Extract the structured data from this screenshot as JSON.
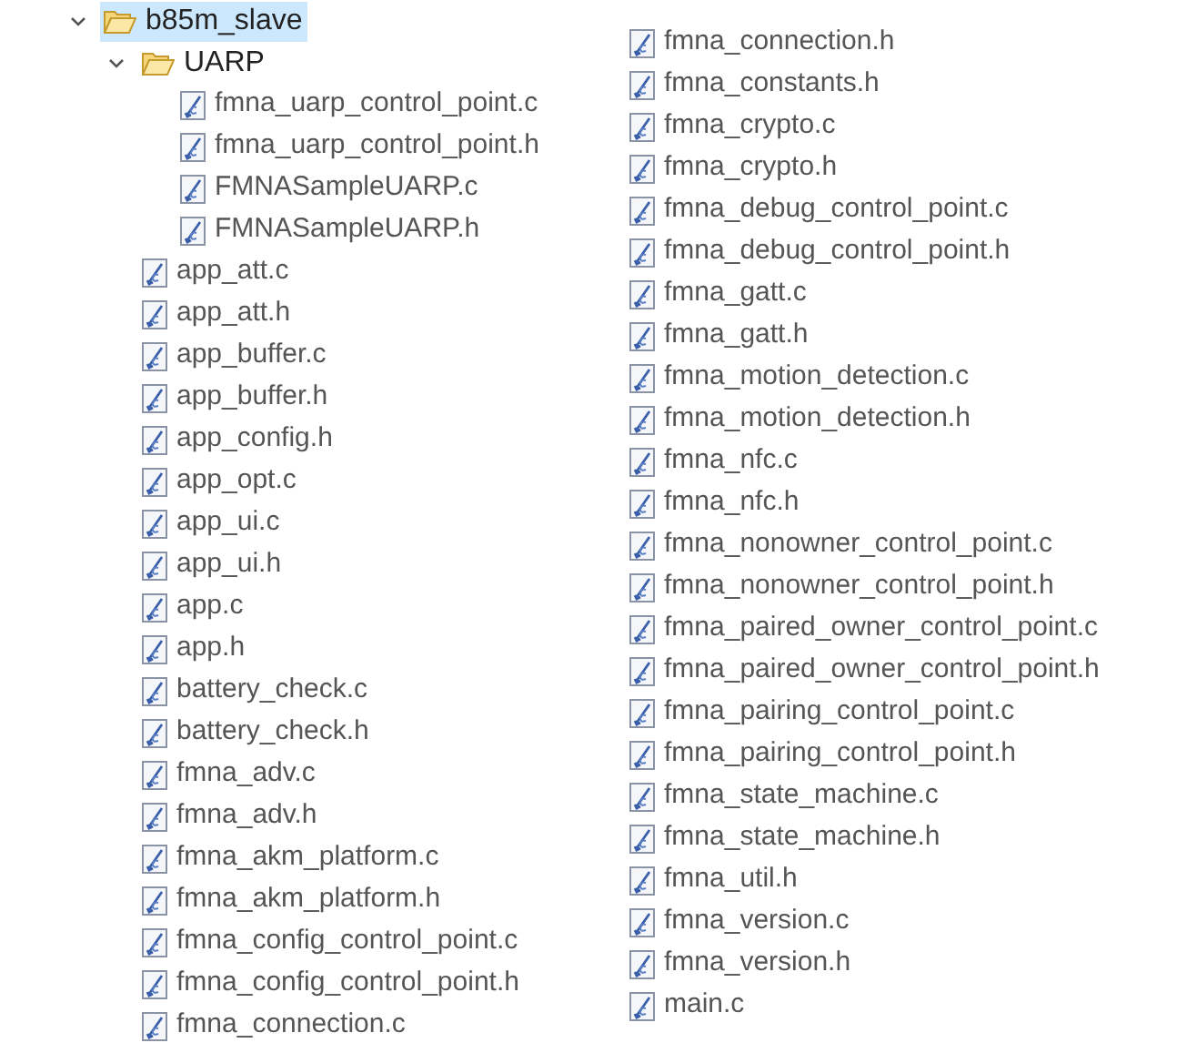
{
  "tree": [
    {
      "kind": "folder",
      "label": "b85m_slave",
      "expanded": true,
      "selected": true,
      "children": [
        {
          "kind": "folder",
          "label": "UARP",
          "expanded": true,
          "selected": false,
          "children": [
            {
              "kind": "file",
              "label": "fmna_uarp_control_point.c"
            },
            {
              "kind": "file",
              "label": "fmna_uarp_control_point.h"
            },
            {
              "kind": "file",
              "label": "FMNASampleUARP.c"
            },
            {
              "kind": "file",
              "label": "FMNASampleUARP.h"
            }
          ]
        },
        {
          "kind": "file",
          "label": "app_att.c"
        },
        {
          "kind": "file",
          "label": "app_att.h"
        },
        {
          "kind": "file",
          "label": "app_buffer.c"
        },
        {
          "kind": "file",
          "label": "app_buffer.h"
        },
        {
          "kind": "file",
          "label": "app_config.h"
        },
        {
          "kind": "file",
          "label": "app_opt.c"
        },
        {
          "kind": "file",
          "label": "app_ui.c"
        },
        {
          "kind": "file",
          "label": "app_ui.h"
        },
        {
          "kind": "file",
          "label": "app.c"
        },
        {
          "kind": "file",
          "label": "app.h"
        },
        {
          "kind": "file",
          "label": "battery_check.c"
        },
        {
          "kind": "file",
          "label": "battery_check.h"
        },
        {
          "kind": "file",
          "label": "fmna_adv.c"
        },
        {
          "kind": "file",
          "label": "fmna_adv.h"
        },
        {
          "kind": "file",
          "label": "fmna_akm_platform.c"
        },
        {
          "kind": "file",
          "label": "fmna_akm_platform.h"
        },
        {
          "kind": "file",
          "label": "fmna_config_control_point.c"
        },
        {
          "kind": "file",
          "label": "fmna_config_control_point.h"
        },
        {
          "kind": "file",
          "label": "fmna_connection.c"
        }
      ]
    }
  ],
  "continued": [
    {
      "kind": "file",
      "label": "fmna_connection.h"
    },
    {
      "kind": "file",
      "label": "fmna_constants.h"
    },
    {
      "kind": "file",
      "label": "fmna_crypto.c"
    },
    {
      "kind": "file",
      "label": "fmna_crypto.h"
    },
    {
      "kind": "file",
      "label": "fmna_debug_control_point.c"
    },
    {
      "kind": "file",
      "label": "fmna_debug_control_point.h"
    },
    {
      "kind": "file",
      "label": "fmna_gatt.c"
    },
    {
      "kind": "file",
      "label": "fmna_gatt.h"
    },
    {
      "kind": "file",
      "label": "fmna_motion_detection.c"
    },
    {
      "kind": "file",
      "label": "fmna_motion_detection.h"
    },
    {
      "kind": "file",
      "label": "fmna_nfc.c"
    },
    {
      "kind": "file",
      "label": "fmna_nfc.h"
    },
    {
      "kind": "file",
      "label": "fmna_nonowner_control_point.c"
    },
    {
      "kind": "file",
      "label": "fmna_nonowner_control_point.h"
    },
    {
      "kind": "file",
      "label": "fmna_paired_owner_control_point.c"
    },
    {
      "kind": "file",
      "label": "fmna_paired_owner_control_point.h"
    },
    {
      "kind": "file",
      "label": "fmna_pairing_control_point.c"
    },
    {
      "kind": "file",
      "label": "fmna_pairing_control_point.h"
    },
    {
      "kind": "file",
      "label": "fmna_state_machine.c"
    },
    {
      "kind": "file",
      "label": "fmna_state_machine.h"
    },
    {
      "kind": "file",
      "label": "fmna_util.h"
    },
    {
      "kind": "file",
      "label": "fmna_version.c"
    },
    {
      "kind": "file",
      "label": "fmna_version.h"
    },
    {
      "kind": "file",
      "label": "main.c"
    }
  ]
}
